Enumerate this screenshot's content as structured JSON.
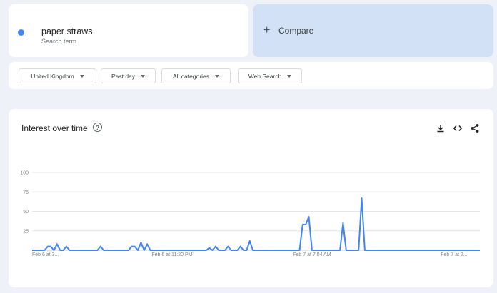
{
  "search_term": {
    "name": "paper straws",
    "subtitle": "Search term",
    "color": "#4285f4"
  },
  "compare": {
    "plus": "+",
    "label": "Compare"
  },
  "filters": {
    "region": "United Kingdom",
    "time": "Past day",
    "category": "All categories",
    "property": "Web Search"
  },
  "interest_card": {
    "title": "Interest over time",
    "help_glyph": "?",
    "actions": [
      "download-icon",
      "embed-icon",
      "share-icon"
    ]
  },
  "chart_data": {
    "type": "line",
    "color": "#4285f4",
    "ylim": [
      0,
      100
    ],
    "yticks": [
      {
        "value": 100,
        "label": "100"
      },
      {
        "value": 75,
        "label": "75"
      },
      {
        "value": 50,
        "label": "50"
      },
      {
        "value": 25,
        "label": "25"
      }
    ],
    "xticks": [
      {
        "index": 0,
        "label": "Feb 6 at 3..."
      },
      {
        "index": 45,
        "label": "Feb 6 at 11:20 PM"
      },
      {
        "index": 90,
        "label": "Feb 7 at 7:04 AM"
      },
      {
        "index": 140,
        "label": "Feb 7 at 2..."
      }
    ],
    "grid": true,
    "series": [
      {
        "values": [
          0,
          0,
          0,
          0,
          0,
          5,
          5,
          0,
          8,
          0,
          0,
          5,
          0,
          0,
          0,
          0,
          0,
          0,
          0,
          0,
          0,
          0,
          5,
          0,
          0,
          0,
          0,
          0,
          0,
          0,
          0,
          0,
          5,
          5,
          0,
          10,
          0,
          8,
          0,
          0,
          0,
          0,
          0,
          0,
          0,
          0,
          0,
          0,
          0,
          0,
          0,
          0,
          0,
          0,
          0,
          0,
          0,
          3,
          0,
          5,
          0,
          0,
          0,
          5,
          0,
          0,
          0,
          5,
          0,
          0,
          12,
          0,
          0,
          0,
          0,
          0,
          0,
          0,
          0,
          0,
          0,
          0,
          0,
          0,
          0,
          0,
          0,
          33,
          33,
          43,
          0,
          0,
          0,
          0,
          0,
          0,
          0,
          0,
          0,
          0,
          35,
          0,
          0,
          0,
          0,
          0,
          67,
          0,
          0,
          0,
          0,
          0,
          0,
          0,
          0,
          0,
          0,
          0,
          0,
          0,
          0,
          0,
          0,
          0,
          0,
          0,
          0,
          0,
          0,
          0,
          0,
          0,
          0,
          0,
          0,
          0,
          0,
          0,
          0,
          0,
          0,
          0,
          0,
          0,
          0
        ]
      }
    ]
  }
}
